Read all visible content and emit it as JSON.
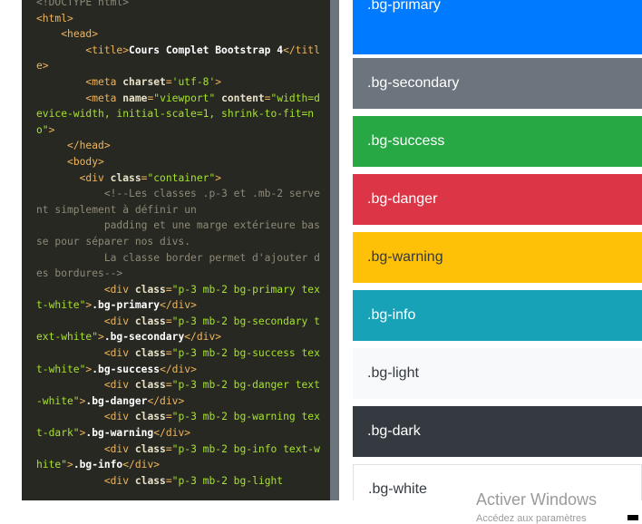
{
  "code": {
    "lines": [
      {
        "t": "<!DOCTYPE html>",
        "k": "cm"
      },
      {
        "t": "<html>",
        "k": "tag"
      },
      {
        "t": "    <head>",
        "k": "tag"
      },
      {
        "t": "        <title>",
        "k": "tag",
        "rest": [
          {
            "t": "Cours Complet Bootstrap 4",
            "k": "txt"
          },
          {
            "t": "</title>",
            "k": "tag"
          }
        ]
      },
      {
        "t": "        <meta ",
        "k": "tag",
        "rest": [
          {
            "t": "charset",
            "k": "attr"
          },
          {
            "t": "=",
            "k": "punc"
          },
          {
            "t": "'utf-8'",
            "k": "str"
          },
          {
            "t": ">",
            "k": "tag"
          }
        ]
      },
      {
        "t": "        <meta ",
        "k": "tag",
        "rest": [
          {
            "t": "name",
            "k": "attr"
          },
          {
            "t": "=",
            "k": "punc"
          },
          {
            "t": "\"viewport\"",
            "k": "str"
          },
          {
            "t": " content",
            "k": "attr"
          },
          {
            "t": "=",
            "k": "punc"
          },
          {
            "t": "\"width=device-width, initial-scale=1, shrink-to-fit=no\"",
            "k": "str"
          },
          {
            "t": ">",
            "k": "tag"
          }
        ]
      },
      {
        "t": "     </head>",
        "k": "tag"
      },
      {
        "t": "     <body>",
        "k": "tag"
      },
      {
        "t": "       <div ",
        "k": "tag",
        "rest": [
          {
            "t": "class",
            "k": "attr"
          },
          {
            "t": "=",
            "k": "punc"
          },
          {
            "t": "\"container\"",
            "k": "str"
          },
          {
            "t": ">",
            "k": "tag"
          }
        ]
      },
      {
        "t": "           <!--Les classes .p-3 et .mb-2 servent simplement à définir un",
        "k": "cm"
      },
      {
        "t": "           padding et une marge extérieure basse pour séparer nos divs.",
        "k": "cm"
      },
      {
        "t": "           La classe border permet d'ajouter des bordures-->",
        "k": "cm"
      },
      {
        "t": "           <div ",
        "k": "tag",
        "rest": [
          {
            "t": "class",
            "k": "attr"
          },
          {
            "t": "=",
            "k": "punc"
          },
          {
            "t": "\"p-3 mb-2 bg-primary text-white\"",
            "k": "str"
          },
          {
            "t": ">",
            "k": "tag"
          },
          {
            "t": ".bg-primary",
            "k": "txt"
          },
          {
            "t": "</div>",
            "k": "tag"
          }
        ]
      },
      {
        "t": "           <div ",
        "k": "tag",
        "rest": [
          {
            "t": "class",
            "k": "attr"
          },
          {
            "t": "=",
            "k": "punc"
          },
          {
            "t": "\"p-3 mb-2 bg-secondary text-white\"",
            "k": "str"
          },
          {
            "t": ">",
            "k": "tag"
          },
          {
            "t": ".bg-secondary",
            "k": "txt"
          },
          {
            "t": "</div>",
            "k": "tag"
          }
        ]
      },
      {
        "t": "           <div ",
        "k": "tag",
        "rest": [
          {
            "t": "class",
            "k": "attr"
          },
          {
            "t": "=",
            "k": "punc"
          },
          {
            "t": "\"p-3 mb-2 bg-success text-white\"",
            "k": "str"
          },
          {
            "t": ">",
            "k": "tag"
          },
          {
            "t": ".bg-success",
            "k": "txt"
          },
          {
            "t": "</div>",
            "k": "tag"
          }
        ]
      },
      {
        "t": "           <div ",
        "k": "tag",
        "rest": [
          {
            "t": "class",
            "k": "attr"
          },
          {
            "t": "=",
            "k": "punc"
          },
          {
            "t": "\"p-3 mb-2 bg-danger text-white\"",
            "k": "str"
          },
          {
            "t": ">",
            "k": "tag"
          },
          {
            "t": ".bg-danger",
            "k": "txt"
          },
          {
            "t": "</div>",
            "k": "tag"
          }
        ]
      },
      {
        "t": "           <div ",
        "k": "tag",
        "rest": [
          {
            "t": "class",
            "k": "attr"
          },
          {
            "t": "=",
            "k": "punc"
          },
          {
            "t": "\"p-3 mb-2 bg-warning text-dark\"",
            "k": "str"
          },
          {
            "t": ">",
            "k": "tag"
          },
          {
            "t": ".bg-warning",
            "k": "txt"
          },
          {
            "t": "</div>",
            "k": "tag"
          }
        ]
      },
      {
        "t": "           <div ",
        "k": "tag",
        "rest": [
          {
            "t": "class",
            "k": "attr"
          },
          {
            "t": "=",
            "k": "punc"
          },
          {
            "t": "\"p-3 mb-2 bg-info text-white\"",
            "k": "str"
          },
          {
            "t": ">",
            "k": "tag"
          },
          {
            "t": ".bg-info",
            "k": "txt"
          },
          {
            "t": "</div>",
            "k": "tag"
          }
        ]
      },
      {
        "t": "           <div ",
        "k": "tag",
        "rest": [
          {
            "t": "class",
            "k": "attr"
          },
          {
            "t": "=",
            "k": "punc"
          },
          {
            "t": "\"p-3 mb-2 bg-light",
            "k": "str"
          }
        ]
      }
    ]
  },
  "swatches": [
    {
      "label": ".bg-primary",
      "bg": "#007bff",
      "fg": "#ffffff"
    },
    {
      "label": ".bg-secondary",
      "bg": "#6c757d",
      "fg": "#ffffff"
    },
    {
      "label": ".bg-success",
      "bg": "#28a745",
      "fg": "#ffffff"
    },
    {
      "label": ".bg-danger",
      "bg": "#dc3545",
      "fg": "#ffffff"
    },
    {
      "label": ".bg-warning",
      "bg": "#ffc107",
      "fg": "#343a40"
    },
    {
      "label": ".bg-info",
      "bg": "#17a2b8",
      "fg": "#ffffff"
    },
    {
      "label": ".bg-light",
      "bg": "#f8f9fa",
      "fg": "#343a40"
    },
    {
      "label": ".bg-dark",
      "bg": "#343a40",
      "fg": "#ffffff"
    },
    {
      "label": ".bg-white",
      "bg": "#ffffff",
      "fg": "#343a40"
    }
  ],
  "watermark": {
    "title": "Activer Windows",
    "subtitle": "Accédez aux paramètres"
  }
}
